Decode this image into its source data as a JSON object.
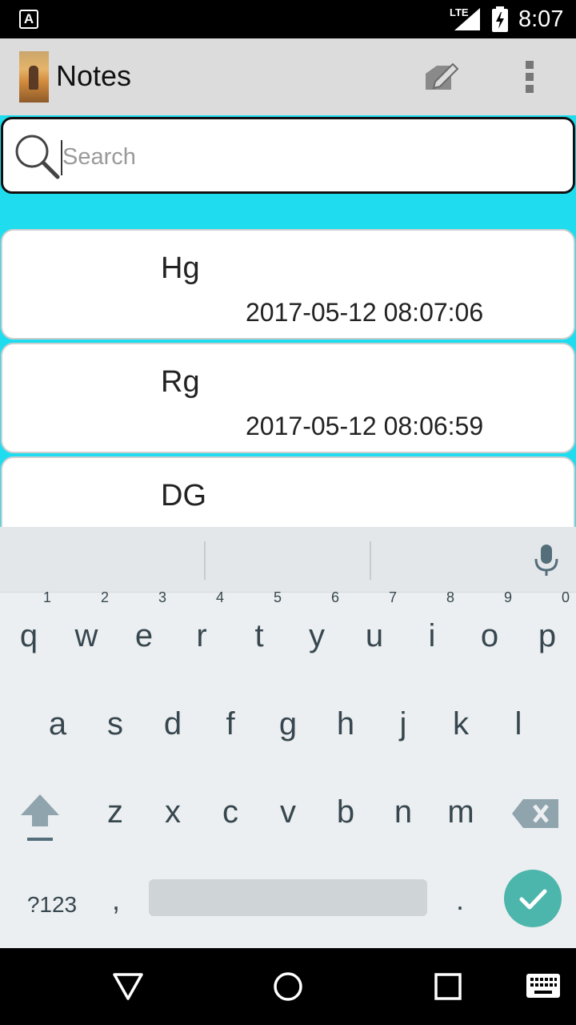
{
  "status_bar": {
    "network_type": "LTE",
    "time": "8:07",
    "notification_icon": "a-icon",
    "signal_icon": "signal-icon",
    "battery_icon": "battery-charging-icon"
  },
  "action_bar": {
    "title": "Notes",
    "compose_icon": "compose-icon",
    "overflow_icon": "overflow-menu-icon"
  },
  "search": {
    "placeholder": "Search",
    "value": "",
    "icon": "search-icon"
  },
  "notes": [
    {
      "title": "Hg",
      "timestamp": "2017-05-12 08:07:06"
    },
    {
      "title": "Rg",
      "timestamp": "2017-05-12 08:06:59"
    },
    {
      "title": "DG",
      "timestamp": ""
    }
  ],
  "keyboard": {
    "row1": [
      {
        "key": "q",
        "hint": "1"
      },
      {
        "key": "w",
        "hint": "2"
      },
      {
        "key": "e",
        "hint": "3"
      },
      {
        "key": "r",
        "hint": "4"
      },
      {
        "key": "t",
        "hint": "5"
      },
      {
        "key": "y",
        "hint": "6"
      },
      {
        "key": "u",
        "hint": "7"
      },
      {
        "key": "i",
        "hint": "8"
      },
      {
        "key": "o",
        "hint": "9"
      },
      {
        "key": "p",
        "hint": "0"
      }
    ],
    "row2": [
      "a",
      "s",
      "d",
      "f",
      "g",
      "h",
      "j",
      "k",
      "l"
    ],
    "row3": [
      "z",
      "x",
      "c",
      "v",
      "b",
      "n",
      "m"
    ],
    "symbols_label": "?123",
    "comma_label": ",",
    "period_label": ".",
    "accent_color": "#4db6ac"
  },
  "nav_bar": {
    "back_icon": "back-triangle-icon",
    "home_icon": "home-circle-icon",
    "recents_icon": "recents-square-icon",
    "keyboard_icon": "keyboard-icon"
  }
}
